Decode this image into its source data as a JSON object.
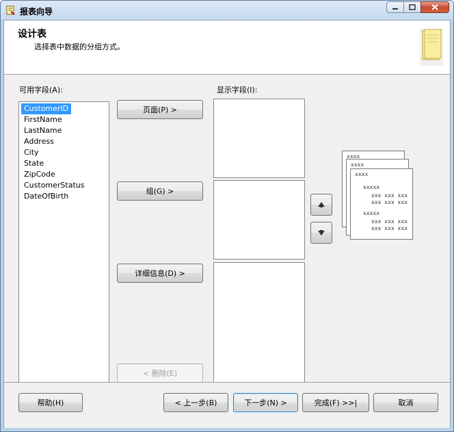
{
  "window": {
    "title": "报表向导"
  },
  "header": {
    "title": "设计表",
    "subtitle": "选择表中数据的分组方式。"
  },
  "available": {
    "label": "可用字段(A):",
    "items": [
      "CustomerID",
      "FirstName",
      "LastName",
      "Address",
      "City",
      "State",
      "ZipCode",
      "CustomerStatus",
      "DateOfBirth"
    ],
    "selected": "CustomerID"
  },
  "display": {
    "label": "显示字段(I):"
  },
  "buttons": {
    "page": "页面(P) >",
    "group": "组(G) >",
    "details": "详细信息(D) >",
    "remove": "< 删除(E)"
  },
  "preview": {
    "row1": "xxxx",
    "row2": "xxxx",
    "row3": "xxxx",
    "sub1": "xxxxx",
    "line1": "xxx xxx xxx",
    "line2": "xxx xxx xxx",
    "sub2": "xxxxx",
    "line3": "xxx xxx xxx",
    "line4": "xxx xxx xxx"
  },
  "footer": {
    "help": "帮助(H)",
    "back": "< 上一步(B)",
    "next": "下一步(N) >",
    "finish": "完成(F) >>|",
    "cancel": "取消"
  }
}
